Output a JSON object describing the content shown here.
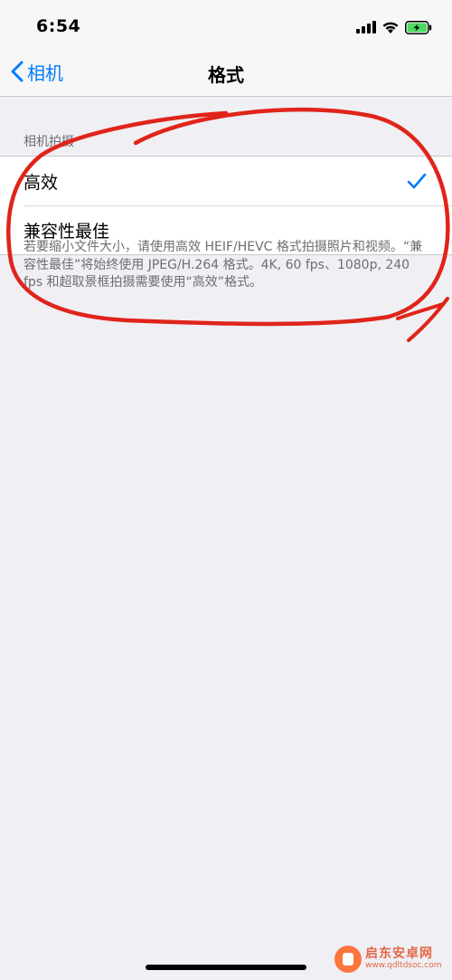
{
  "status_bar": {
    "time": "6:54",
    "icons": [
      "signal-icon",
      "wifi-icon",
      "battery-charging-icon"
    ],
    "battery_color": "#4cd964"
  },
  "nav": {
    "back_label": "相机",
    "title": "格式",
    "accent_color": "#007aff"
  },
  "section": {
    "header": "相机拍摄",
    "options": [
      {
        "label": "高效",
        "selected": true
      },
      {
        "label": "兼容性最佳",
        "selected": false
      }
    ],
    "footer": "若要缩小文件大小，请使用高效 HEIF/HEVC 格式拍摄照片和视频。“兼容性最佳”将始终使用 JPEG/H.264 格式。4K, 60 fps、1080p, 240 fps 和超取景框拍摄需要使用“高效”格式。"
  },
  "annotation": {
    "color": "#e0241a"
  },
  "watermark": {
    "name": "启东安卓网",
    "url": "www.qdltdsoc.com"
  }
}
